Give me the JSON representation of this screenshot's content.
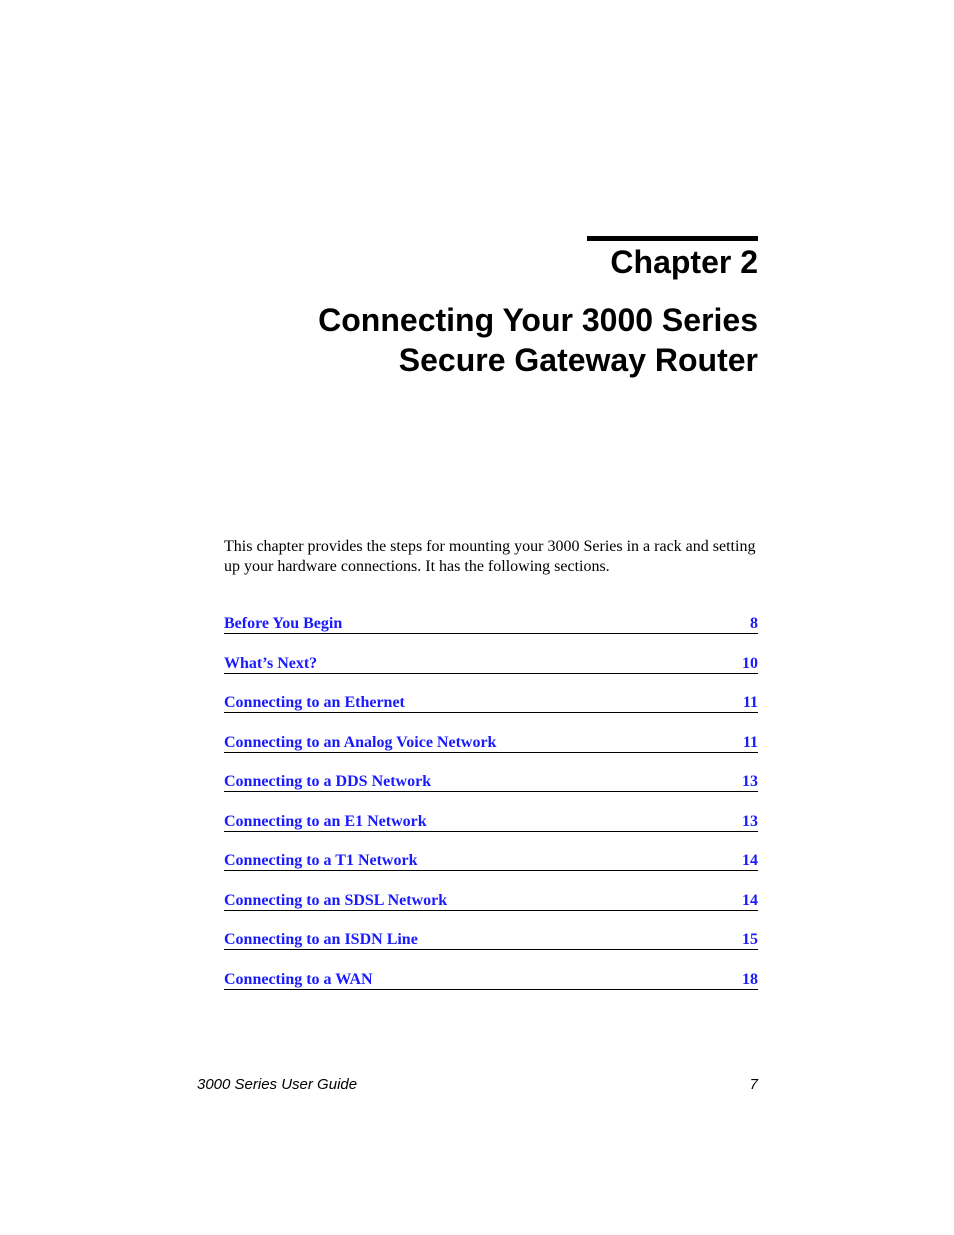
{
  "chapter": {
    "label": "Chapter 2",
    "title_line1": "Connecting Your 3000 Series",
    "title_line2": "Secure Gateway Router"
  },
  "intro": "This chapter provides the steps for mounting your 3000 Series in a rack and setting up your hardware connections. It has the following sections.",
  "toc": [
    {
      "title": "Before You Begin",
      "page": "8"
    },
    {
      "title": "What’s Next?",
      "page": "10"
    },
    {
      "title": "Connecting to an Ethernet",
      "page": "11"
    },
    {
      "title": "Connecting to an Analog Voice Network",
      "page": "11"
    },
    {
      "title": "Connecting to a DDS Network",
      "page": "13"
    },
    {
      "title": "Connecting to an E1 Network",
      "page": "13"
    },
    {
      "title": "Connecting to a T1 Network",
      "page": "14"
    },
    {
      "title": "Connecting to an SDSL Network",
      "page": "14"
    },
    {
      "title": "Connecting to an ISDN Line",
      "page": "15"
    },
    {
      "title": "Connecting to a WAN",
      "page": "18"
    }
  ],
  "footer": {
    "guide_name": "3000 Series User Guide",
    "page_number": "7"
  },
  "colors": {
    "link": "#1a1aff",
    "text": "#000000"
  }
}
